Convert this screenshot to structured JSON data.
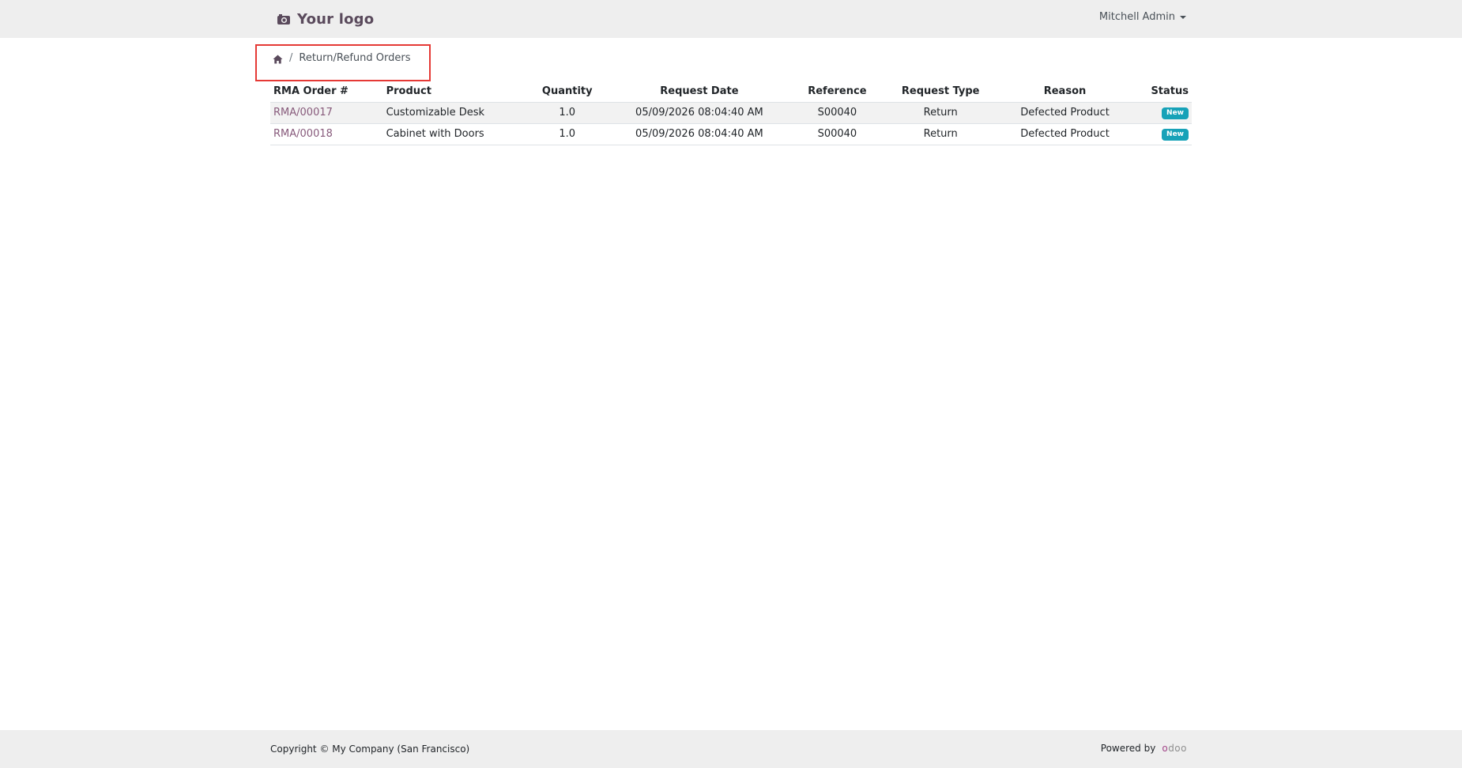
{
  "header": {
    "logo_text": "Your logo",
    "user_name": "Mitchell Admin"
  },
  "breadcrumb": {
    "separator": "/",
    "current": "Return/Refund Orders"
  },
  "table": {
    "columns": [
      "RMA Order #",
      "Product",
      "Quantity",
      "Request Date",
      "Reference",
      "Request Type",
      "Reason",
      "Status"
    ],
    "rows": [
      {
        "rma_order": "RMA/00017",
        "product": "Customizable Desk",
        "quantity": "1.0",
        "request_date": "05/09/2026 08:04:40 AM",
        "reference": "S00040",
        "request_type": "Return",
        "reason": "Defected Product",
        "status": "New"
      },
      {
        "rma_order": "RMA/00018",
        "product": "Cabinet with Doors",
        "quantity": "1.0",
        "request_date": "05/09/2026 08:04:40 AM",
        "reference": "S00040",
        "request_type": "Return",
        "reason": "Defected Product",
        "status": "New"
      }
    ]
  },
  "footer": {
    "copyright": "Copyright © My Company (San Francisco)",
    "powered_by": "Powered by",
    "brand_part1": "o",
    "brand_part2": "doo"
  },
  "icons": {
    "logo_icon": "camera-icon",
    "home_icon": "home-icon",
    "dropdown_icon": "caret-down-icon"
  },
  "colors": {
    "link": "#875a7b",
    "badge": "#17a2b8",
    "highlight_border": "#e53935",
    "logo_text": "#5a4a5c"
  }
}
